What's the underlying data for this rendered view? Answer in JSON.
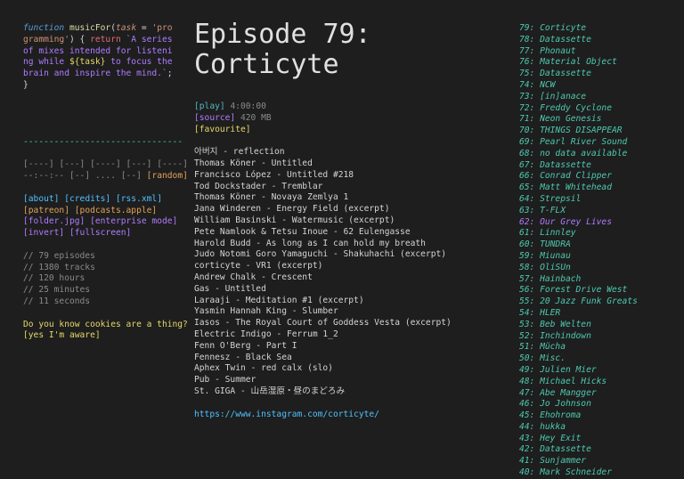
{
  "code_snippet": {
    "kw_function": "function",
    "fn_name": "musicFor",
    "paren_open": "(",
    "arg": "task",
    "eq": " = ",
    "default": "'programming'",
    "close": ") { ",
    "kw_return": "return",
    "template_start": " `A series of mixes intended for listening while ",
    "template_var": "${task}",
    "template_end": " to focus the brain and inspire the mind.`",
    "end": "; }"
  },
  "divider": "-------------------------------",
  "player": {
    "row1": [
      "[----]",
      "[---]",
      "[----]",
      "[---]",
      "[----]"
    ],
    "time": "--:--:--",
    "row2_controls": [
      "[--]",
      "....",
      "[--]"
    ],
    "random": "[random]"
  },
  "links": {
    "about": "[about]",
    "credits": "[credits]",
    "rss": "[rss.xml]",
    "patreon": "[patreon]",
    "podcasts": "[podcasts.apple]",
    "folder": "[folder.jpg]",
    "enterprise": "[enterprise mode]",
    "invert": "[invert]",
    "fullscreen": "[fullscreen]"
  },
  "stats": [
    "// 79 episodes",
    "// 1380 tracks",
    "// 120 hours",
    "// 25 minutes",
    "// 11 seconds"
  ],
  "cookies": {
    "question": "Do you know cookies are a thing?",
    "answer": "[yes I'm aware]"
  },
  "episode": {
    "title_line1": "Episode 79:",
    "title_line2": "Corticyte",
    "play_label": "[play]",
    "duration": "4:00:00",
    "source_label": "[source]",
    "size": "420 MB",
    "favourite_label": "[favourite]",
    "tracks": [
      "아버지 - reflection",
      "Thomas Köner - Untitled",
      "Francisco López - Untitled #218",
      "Tod Dockstader - Tremblar",
      "Thomas Köner - Novaya Zemlya 1",
      "Jana Winderen - Energy Field (excerpt)",
      "William Basinski - Watermusic (excerpt)",
      "Pete Namlook & Tetsu Inoue - 62 Eulengasse",
      "Harold Budd - As long as I can hold my breath",
      "Judo Notomi Goro Yamaguchi - Shakuhachi (excerpt)",
      "corticyte - VR1 (excerpt)",
      "Andrew Chalk - Crescent",
      "Gas - Untitled",
      "Laraaji - Meditation #1 (excerpt)",
      "Yasmin Hannah King - Slumber",
      "Iasos - The Royal Court of Goddess Vesta (excerpt)",
      "Electric Indigo - Ferrum 1_2",
      "Fenn O'Berg - Part I",
      "Fennesz - Black Sea",
      "Aphex Twin - red calx (slo)",
      "Pub - Summer",
      "St. GIGA - 山岳湿原・昼のまどろみ"
    ],
    "link": "https://www.instagram.com/corticyte/"
  },
  "episode_list": [
    {
      "label": "79: Corticyte",
      "color": "#4ec9b0"
    },
    {
      "label": "78: Datassette",
      "color": "#4ec9b0"
    },
    {
      "label": "77: Phonaut",
      "color": "#4ec9b0"
    },
    {
      "label": "76: Material Object",
      "color": "#4ec9b0"
    },
    {
      "label": "75: Datassette",
      "color": "#4ec9b0"
    },
    {
      "label": "74: NCW",
      "color": "#4ec9b0"
    },
    {
      "label": "73: [in]anace",
      "color": "#4ec9b0"
    },
    {
      "label": "72: Freddy Cyclone",
      "color": "#4ec9b0"
    },
    {
      "label": "71: Neon Genesis",
      "color": "#4ec9b0"
    },
    {
      "label": "70: THINGS DISAPPEAR",
      "color": "#4ec9b0"
    },
    {
      "label": "69: Pearl River Sound",
      "color": "#4ec9b0"
    },
    {
      "label": "68: no data available",
      "color": "#4ec9b0"
    },
    {
      "label": "67: Datassette",
      "color": "#4ec9b0"
    },
    {
      "label": "66: Conrad Clipper",
      "color": "#4ec9b0"
    },
    {
      "label": "65: Matt Whitehead",
      "color": "#4ec9b0"
    },
    {
      "label": "64: Strepsil",
      "color": "#4ec9b0"
    },
    {
      "label": "63: T-FLX",
      "color": "#4ec9b0"
    },
    {
      "label": "62: Our Grey Lives",
      "color": "#b07cff"
    },
    {
      "label": "61: Linnley",
      "color": "#4ec9b0"
    },
    {
      "label": "60: TUNDRA",
      "color": "#4ec9b0"
    },
    {
      "label": "59: Miunau",
      "color": "#4ec9b0"
    },
    {
      "label": "58: OliSUn",
      "color": "#4ec9b0"
    },
    {
      "label": "57: Hainbach",
      "color": "#4ec9b0"
    },
    {
      "label": "56: Forest Drive West",
      "color": "#4ec9b0"
    },
    {
      "label": "55: 20 Jazz Funk Greats",
      "color": "#4ec9b0"
    },
    {
      "label": "54: HLER",
      "color": "#4ec9b0"
    },
    {
      "label": "53: Beb Welten",
      "color": "#4ec9b0"
    },
    {
      "label": "52: Inchindown",
      "color": "#4ec9b0"
    },
    {
      "label": "51: Mücha",
      "color": "#4ec9b0"
    },
    {
      "label": "50: Misc.",
      "color": "#4ec9b0"
    },
    {
      "label": "49: Julien Mier",
      "color": "#4ec9b0"
    },
    {
      "label": "48: Michael Hicks",
      "color": "#4ec9b0"
    },
    {
      "label": "47: Abe Mangger",
      "color": "#4ec9b0"
    },
    {
      "label": "46: Jo Johnson",
      "color": "#4ec9b0"
    },
    {
      "label": "45: Ehohroma",
      "color": "#4ec9b0"
    },
    {
      "label": "44: hukka",
      "color": "#4ec9b0"
    },
    {
      "label": "43: Hey Exit",
      "color": "#4ec9b0"
    },
    {
      "label": "42: Datassette",
      "color": "#4ec9b0"
    },
    {
      "label": "41: Sunjammer",
      "color": "#4ec9b0"
    },
    {
      "label": "40: Mark Schneider",
      "color": "#4ec9b0"
    }
  ]
}
